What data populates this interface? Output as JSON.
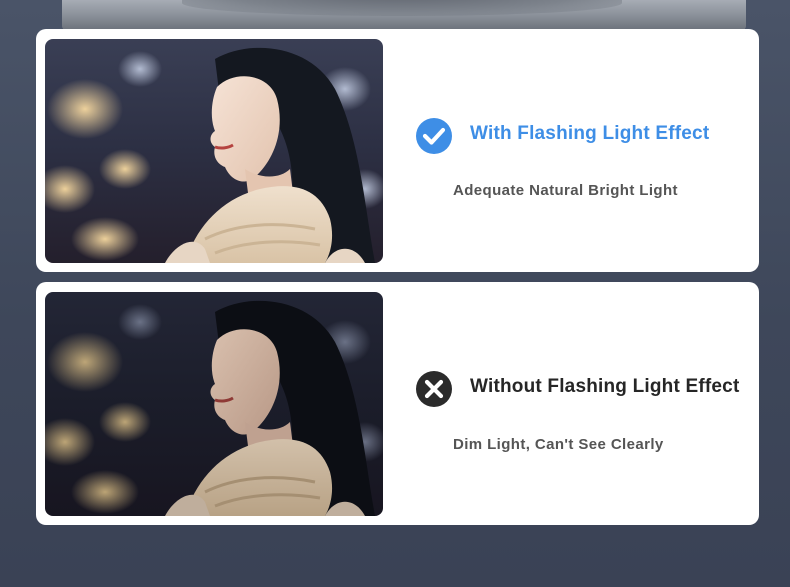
{
  "comparison": [
    {
      "status": "positive",
      "icon": "check-circle-icon",
      "accent_color": "#3e8ee6",
      "title": "With Flashing Light Effect",
      "subtitle": "Adequate Natural Bright Light"
    },
    {
      "status": "negative",
      "icon": "x-circle-icon",
      "accent_color": "#2b2b2b",
      "title": "Without Flashing Light Effect",
      "subtitle": "Dim Light, Can't See Clearly"
    }
  ]
}
